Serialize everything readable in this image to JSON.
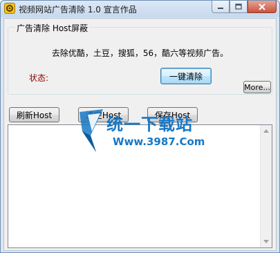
{
  "window": {
    "title": "视频网站广告清除  1.0  宣言作品",
    "icon": "gear-icon"
  },
  "groupbox": {
    "title": "广告清除  Host屏蔽",
    "description": "去除优酷，土豆，搜狐，56，酷六等视频广告。",
    "status_label": "状态:"
  },
  "buttons": {
    "one_click_clean": "一键清除",
    "more": "More...",
    "refresh_host": "刷新Host",
    "clear_host": "清空Host",
    "save_host": "保存Host"
  },
  "watermark": {
    "title": "统一下载站",
    "url": "Www.3987.Com"
  },
  "colors": {
    "status_label": "#8b0000",
    "watermark": "#1778c6",
    "close_button": "#c9533c"
  }
}
